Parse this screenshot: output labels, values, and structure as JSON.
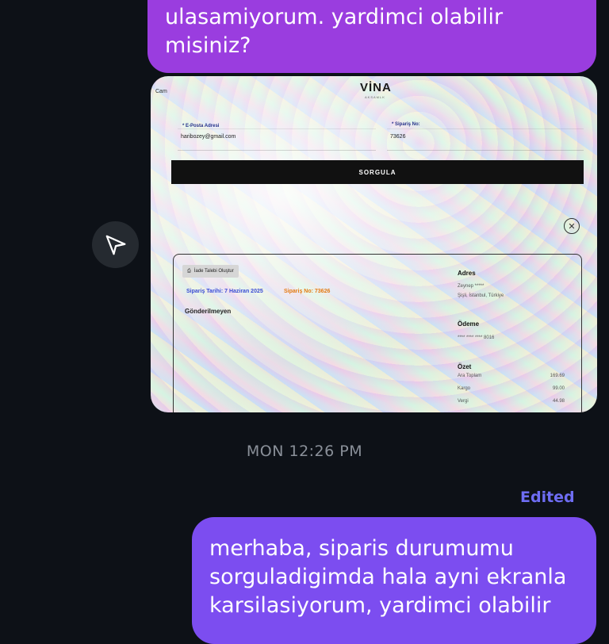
{
  "messages": {
    "top": {
      "lines": [
        "ulasamiyorum. yardimci olabilir",
        "misiniz?"
      ],
      "color": "#9a3ddf"
    },
    "bottom": {
      "lines": [
        "merhaba, siparis durumumu",
        "sorguladigimda hala ayni ekranla",
        "karsilasiyorum, yardimci olabilir"
      ],
      "color": "#7c4df0"
    }
  },
  "photo": {
    "cam_label": "Cam",
    "logo": "VİNA",
    "logo_sub": "AKSAMLK",
    "email_label": "* E-Posta Adresi",
    "email_value": "haribozey@gmail.com",
    "order_label": "* Sipariş No:",
    "order_value": "73626",
    "query_button": "SORGULA",
    "close_icon": "close-icon",
    "return_chip": "İade Talebi Oluştur",
    "order_date": "Sipariş Tarihi: 7 Haziran 2025",
    "order_number": "Sipariş No: 73626",
    "status": "Gönderilmeyen",
    "address_title": "Adres",
    "address_name": "Zeynep *****",
    "address_city": "Şişli, İstanbul, Türkiye",
    "payment_title": "Ödeme",
    "card_number": "**** **** **** 8016",
    "summary_title": "Özet",
    "summary_rows": [
      {
        "label": "Ara Toplam",
        "value": "169.69"
      },
      {
        "label": "Kargo",
        "value": "99.00"
      },
      {
        "label": "Vergi",
        "value": "44.98"
      }
    ]
  },
  "send_icon": "send-icon",
  "timestamp": "MON 12:26 PM",
  "edited_label": "Edited"
}
